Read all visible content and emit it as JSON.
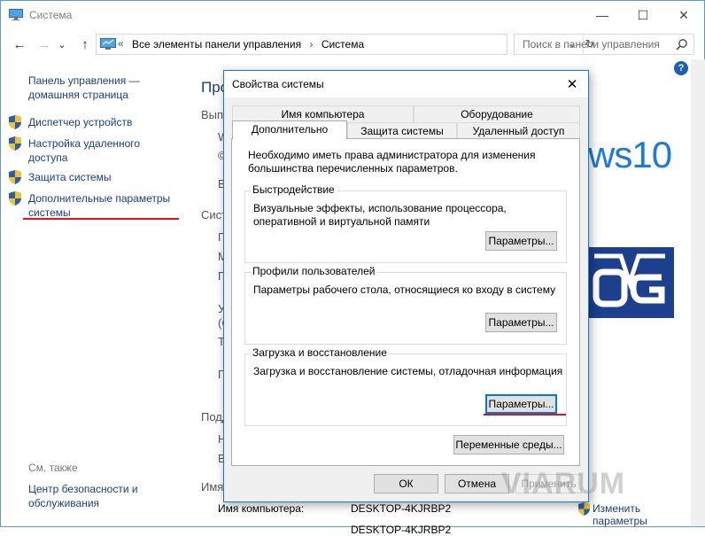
{
  "window": {
    "title": "Система",
    "minimize": "—",
    "maximize": "☐",
    "close": "✕"
  },
  "nav": {
    "back": "←",
    "forward": "→",
    "history": "⌄",
    "up": "↑"
  },
  "address": {
    "path_prefix": "«",
    "crumb1": "Все элементы панели управления",
    "sep": "›",
    "crumb2": "Система",
    "dropdown": "⌄",
    "refresh": "↻"
  },
  "search": {
    "placeholder": "Поиск в панели управления"
  },
  "help": "?",
  "sidebar": {
    "home": "Панель управления — домашняя страница",
    "items": [
      {
        "label": "Диспетчер устройств"
      },
      {
        "label": "Настройка удаленного доступа"
      },
      {
        "label": "Защита системы"
      },
      {
        "label": "Дополнительные параметры системы"
      }
    ],
    "see_also": "См. также",
    "see_also_items": [
      {
        "label": "Центр безопасности и обслуживания"
      }
    ]
  },
  "background": {
    "heading_fragment": "Про",
    "section1_fragment": "Выпу",
    "w_fragment": "W",
    "c_fragment": "©",
    "v_fragment": "В",
    "section2_fragment": "Сист",
    "p1": "П",
    "m": "М",
    "p2": "П",
    "t": "Т",
    "p3": "П",
    "u": "У",
    "paren": "(С",
    "section3_fragment": "Подд",
    "n": "Н",
    "v2": "В",
    "section4_fragment": "Имя",
    "win10": "ws10",
    "pc_name_label": "Имя компьютера:",
    "pc_name": "DESKTOP-4KJRBP2",
    "full_name_partial": "DESKTOP-4KJRBP2",
    "change_params": "Изменить параметры"
  },
  "dialog": {
    "title": "Свойства системы",
    "close": "✕",
    "tabs_row1": [
      "Имя компьютера",
      "Оборудование"
    ],
    "tabs_row2": [
      "Дополнительно",
      "Защита системы",
      "Удаленный доступ"
    ],
    "intro": "Необходимо иметь права администратора для изменения большинства перечисленных параметров.",
    "groups": [
      {
        "title": "Быстродействие",
        "desc": "Визуальные эффекты, использование процессора, оперативной и виртуальной памяти",
        "button": "Параметры..."
      },
      {
        "title": "Профили пользователей",
        "desc": "Параметры рабочего стола, относящиеся ко входу в систему",
        "button": "Параметры..."
      },
      {
        "title": "Загрузка и восстановление",
        "desc": "Загрузка и восстановление системы, отладочная информация",
        "button": "Параметры..."
      }
    ],
    "env_button": "Переменные среды...",
    "ok": "ОК",
    "cancel": "Отмена",
    "apply": "Применить"
  },
  "watermark": "VIARUM",
  "colors": {
    "accent": "#1979ca",
    "link": "#1a3e8a",
    "highlight_underline": "#e8101a",
    "win10_blue": "#1c7bd4"
  }
}
